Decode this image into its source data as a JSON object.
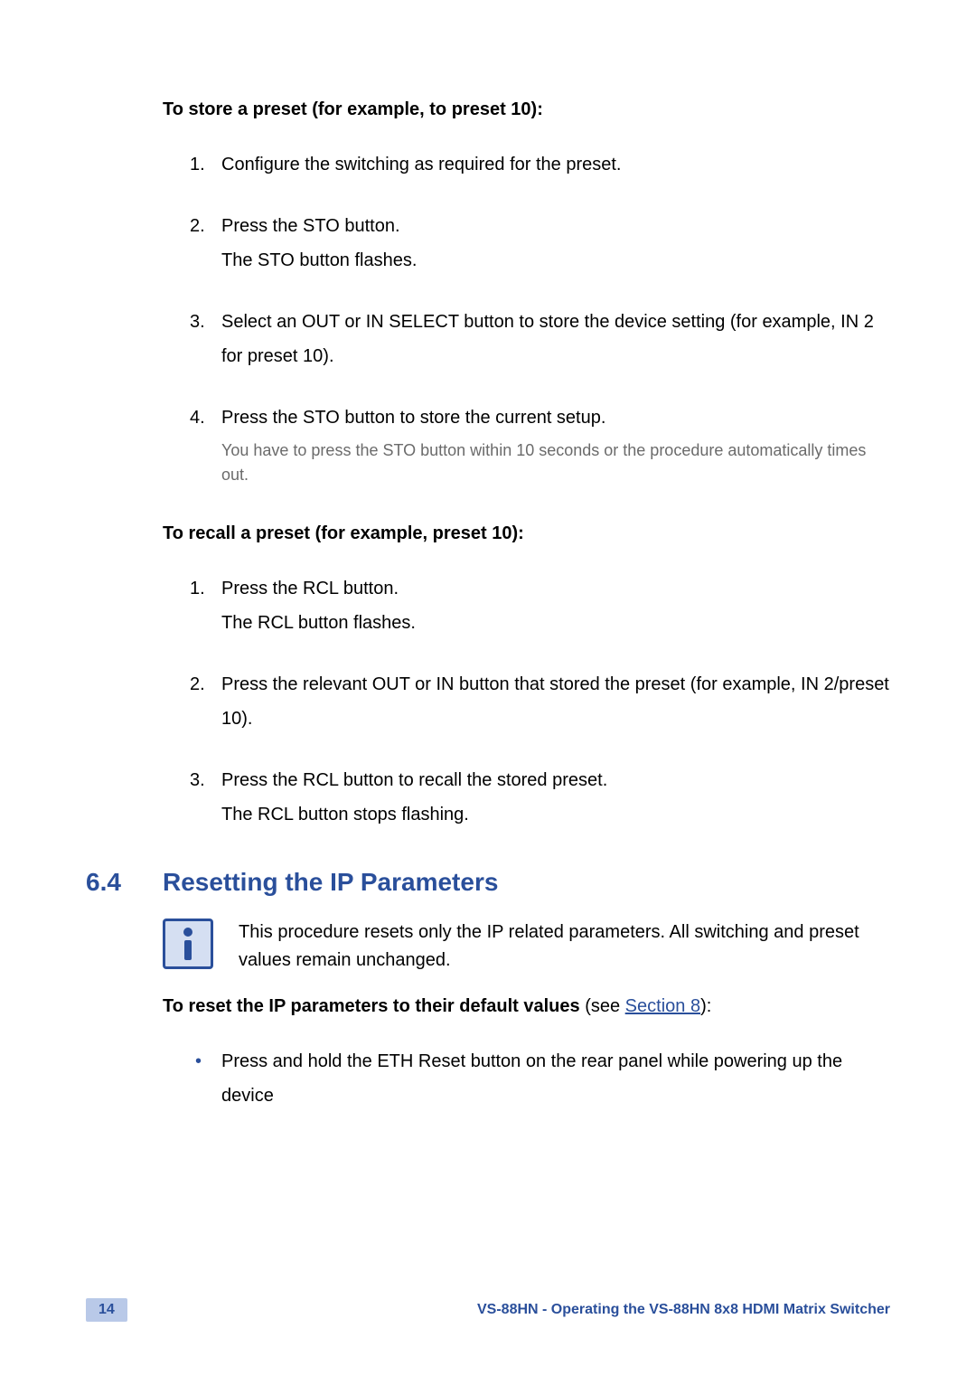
{
  "store_heading": "To store a preset (for example, to preset 10):",
  "store_steps": [
    {
      "n": "1.",
      "text": "Configure the switching as required for the preset.",
      "sub": "",
      "note": ""
    },
    {
      "n": "2.",
      "text": "Press the STO button.",
      "sub": "The STO button flashes.",
      "note": ""
    },
    {
      "n": "3.",
      "text": "Select an OUT or IN SELECT button to store the device setting (for example, IN 2 for preset 10).",
      "sub": "",
      "note": ""
    },
    {
      "n": "4.",
      "text": "Press the STO button to store the current setup.",
      "sub": "",
      "note": "You have to press the STO button within 10 seconds or the procedure automatically times out."
    }
  ],
  "recall_heading": "To recall a preset (for example, preset 10):",
  "recall_steps": [
    {
      "n": "1.",
      "text": "Press the RCL button.",
      "sub": "The RCL button flashes."
    },
    {
      "n": "2.",
      "text": "Press the relevant OUT or IN button that stored the preset (for example, IN 2/preset 10).",
      "sub": ""
    },
    {
      "n": "3.",
      "text": "Press the RCL button to recall the stored preset.",
      "sub": "The RCL button stops flashing."
    }
  ],
  "section": {
    "num": "6.4",
    "title": "Resetting the IP Parameters"
  },
  "info_text": "This procedure resets only the IP related parameters. All switching and preset values remain unchanged.",
  "reset": {
    "bold": "To reset the IP parameters to their default values",
    "plain1": " (see ",
    "link": "Section 8",
    "plain2": "):"
  },
  "reset_bullet": "Press and hold the ETH Reset button on the rear panel while powering up the device",
  "footer": {
    "page": "14",
    "text": "VS-88HN - Operating the VS-88HN 8x8 HDMI Matrix Switcher"
  }
}
